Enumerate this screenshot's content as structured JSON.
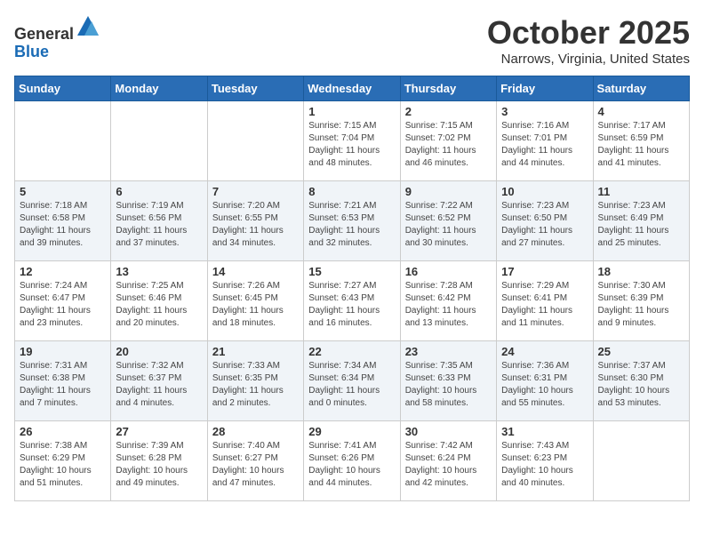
{
  "header": {
    "logo_general": "General",
    "logo_blue": "Blue",
    "month": "October 2025",
    "location": "Narrows, Virginia, United States"
  },
  "days_of_week": [
    "Sunday",
    "Monday",
    "Tuesday",
    "Wednesday",
    "Thursday",
    "Friday",
    "Saturday"
  ],
  "weeks": [
    [
      {
        "day": "",
        "sunrise": "",
        "sunset": "",
        "daylight": ""
      },
      {
        "day": "",
        "sunrise": "",
        "sunset": "",
        "daylight": ""
      },
      {
        "day": "",
        "sunrise": "",
        "sunset": "",
        "daylight": ""
      },
      {
        "day": "1",
        "sunrise": "Sunrise: 7:15 AM",
        "sunset": "Sunset: 7:04 PM",
        "daylight": "Daylight: 11 hours and 48 minutes."
      },
      {
        "day": "2",
        "sunrise": "Sunrise: 7:15 AM",
        "sunset": "Sunset: 7:02 PM",
        "daylight": "Daylight: 11 hours and 46 minutes."
      },
      {
        "day": "3",
        "sunrise": "Sunrise: 7:16 AM",
        "sunset": "Sunset: 7:01 PM",
        "daylight": "Daylight: 11 hours and 44 minutes."
      },
      {
        "day": "4",
        "sunrise": "Sunrise: 7:17 AM",
        "sunset": "Sunset: 6:59 PM",
        "daylight": "Daylight: 11 hours and 41 minutes."
      }
    ],
    [
      {
        "day": "5",
        "sunrise": "Sunrise: 7:18 AM",
        "sunset": "Sunset: 6:58 PM",
        "daylight": "Daylight: 11 hours and 39 minutes."
      },
      {
        "day": "6",
        "sunrise": "Sunrise: 7:19 AM",
        "sunset": "Sunset: 6:56 PM",
        "daylight": "Daylight: 11 hours and 37 minutes."
      },
      {
        "day": "7",
        "sunrise": "Sunrise: 7:20 AM",
        "sunset": "Sunset: 6:55 PM",
        "daylight": "Daylight: 11 hours and 34 minutes."
      },
      {
        "day": "8",
        "sunrise": "Sunrise: 7:21 AM",
        "sunset": "Sunset: 6:53 PM",
        "daylight": "Daylight: 11 hours and 32 minutes."
      },
      {
        "day": "9",
        "sunrise": "Sunrise: 7:22 AM",
        "sunset": "Sunset: 6:52 PM",
        "daylight": "Daylight: 11 hours and 30 minutes."
      },
      {
        "day": "10",
        "sunrise": "Sunrise: 7:23 AM",
        "sunset": "Sunset: 6:50 PM",
        "daylight": "Daylight: 11 hours and 27 minutes."
      },
      {
        "day": "11",
        "sunrise": "Sunrise: 7:23 AM",
        "sunset": "Sunset: 6:49 PM",
        "daylight": "Daylight: 11 hours and 25 minutes."
      }
    ],
    [
      {
        "day": "12",
        "sunrise": "Sunrise: 7:24 AM",
        "sunset": "Sunset: 6:47 PM",
        "daylight": "Daylight: 11 hours and 23 minutes."
      },
      {
        "day": "13",
        "sunrise": "Sunrise: 7:25 AM",
        "sunset": "Sunset: 6:46 PM",
        "daylight": "Daylight: 11 hours and 20 minutes."
      },
      {
        "day": "14",
        "sunrise": "Sunrise: 7:26 AM",
        "sunset": "Sunset: 6:45 PM",
        "daylight": "Daylight: 11 hours and 18 minutes."
      },
      {
        "day": "15",
        "sunrise": "Sunrise: 7:27 AM",
        "sunset": "Sunset: 6:43 PM",
        "daylight": "Daylight: 11 hours and 16 minutes."
      },
      {
        "day": "16",
        "sunrise": "Sunrise: 7:28 AM",
        "sunset": "Sunset: 6:42 PM",
        "daylight": "Daylight: 11 hours and 13 minutes."
      },
      {
        "day": "17",
        "sunrise": "Sunrise: 7:29 AM",
        "sunset": "Sunset: 6:41 PM",
        "daylight": "Daylight: 11 hours and 11 minutes."
      },
      {
        "day": "18",
        "sunrise": "Sunrise: 7:30 AM",
        "sunset": "Sunset: 6:39 PM",
        "daylight": "Daylight: 11 hours and 9 minutes."
      }
    ],
    [
      {
        "day": "19",
        "sunrise": "Sunrise: 7:31 AM",
        "sunset": "Sunset: 6:38 PM",
        "daylight": "Daylight: 11 hours and 7 minutes."
      },
      {
        "day": "20",
        "sunrise": "Sunrise: 7:32 AM",
        "sunset": "Sunset: 6:37 PM",
        "daylight": "Daylight: 11 hours and 4 minutes."
      },
      {
        "day": "21",
        "sunrise": "Sunrise: 7:33 AM",
        "sunset": "Sunset: 6:35 PM",
        "daylight": "Daylight: 11 hours and 2 minutes."
      },
      {
        "day": "22",
        "sunrise": "Sunrise: 7:34 AM",
        "sunset": "Sunset: 6:34 PM",
        "daylight": "Daylight: 11 hours and 0 minutes."
      },
      {
        "day": "23",
        "sunrise": "Sunrise: 7:35 AM",
        "sunset": "Sunset: 6:33 PM",
        "daylight": "Daylight: 10 hours and 58 minutes."
      },
      {
        "day": "24",
        "sunrise": "Sunrise: 7:36 AM",
        "sunset": "Sunset: 6:31 PM",
        "daylight": "Daylight: 10 hours and 55 minutes."
      },
      {
        "day": "25",
        "sunrise": "Sunrise: 7:37 AM",
        "sunset": "Sunset: 6:30 PM",
        "daylight": "Daylight: 10 hours and 53 minutes."
      }
    ],
    [
      {
        "day": "26",
        "sunrise": "Sunrise: 7:38 AM",
        "sunset": "Sunset: 6:29 PM",
        "daylight": "Daylight: 10 hours and 51 minutes."
      },
      {
        "day": "27",
        "sunrise": "Sunrise: 7:39 AM",
        "sunset": "Sunset: 6:28 PM",
        "daylight": "Daylight: 10 hours and 49 minutes."
      },
      {
        "day": "28",
        "sunrise": "Sunrise: 7:40 AM",
        "sunset": "Sunset: 6:27 PM",
        "daylight": "Daylight: 10 hours and 47 minutes."
      },
      {
        "day": "29",
        "sunrise": "Sunrise: 7:41 AM",
        "sunset": "Sunset: 6:26 PM",
        "daylight": "Daylight: 10 hours and 44 minutes."
      },
      {
        "day": "30",
        "sunrise": "Sunrise: 7:42 AM",
        "sunset": "Sunset: 6:24 PM",
        "daylight": "Daylight: 10 hours and 42 minutes."
      },
      {
        "day": "31",
        "sunrise": "Sunrise: 7:43 AM",
        "sunset": "Sunset: 6:23 PM",
        "daylight": "Daylight: 10 hours and 40 minutes."
      },
      {
        "day": "",
        "sunrise": "",
        "sunset": "",
        "daylight": ""
      }
    ]
  ]
}
